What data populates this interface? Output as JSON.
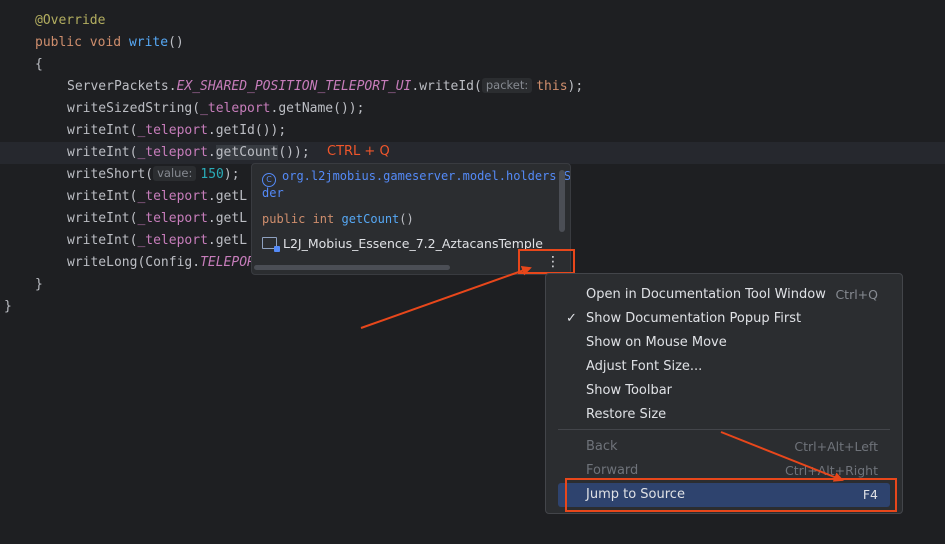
{
  "code": {
    "line1": "@Override",
    "line2_kw1": "public",
    "line2_kw2": "void",
    "line2_fn": "write",
    "line2_rest": "()",
    "line3": "{",
    "line4_a": "ServerPackets.",
    "line4_const": "EX_SHARED_POSITION_TELEPORT_UI",
    "line4_b": ".writeId(",
    "line4_hint": "packet:",
    "line4_this": "this",
    "line4_c": ");",
    "line5_a": "writeSizedString(",
    "line5_f": "_teleport",
    "line5_b": ".getName());",
    "line6_a": "writeInt(",
    "line6_f": "_teleport",
    "line6_b": ".getId());",
    "line7_a": "writeInt(",
    "line7_f": "_teleport",
    "line7_dot": ".",
    "line7_m": "getCount",
    "line7_b": "());",
    "line8_a": "writeShort(",
    "line8_hint": "value:",
    "line8_num": "150",
    "line8_b": ");",
    "line9_a": "writeInt(",
    "line9_f": "_teleport",
    "line9_b": ".getL",
    "line10_a": "writeInt(",
    "line10_f": "_teleport",
    "line10_b": ".getL",
    "line11_a": "writeInt(",
    "line11_f": "_teleport",
    "line11_b": ".getL",
    "line12_a": "writeLong(Config.",
    "line12_const": "TELEPOR",
    "line13": "}",
    "line14": "}"
  },
  "annotation": "CTRL + Q",
  "doc_popup": {
    "class_path_1": "org.l2jmobius.gameserver.model.holders.Sh",
    "class_path_2": "der",
    "signature_kw": "public int",
    "signature_fn": "getCount",
    "signature_rest": "()",
    "module": "L2J_Mobius_Essence_7.2_AztacansTemple",
    "more_label": "⋮"
  },
  "menu": {
    "items": [
      {
        "label": "Open in Documentation Tool Window",
        "shortcut": "Ctrl+Q"
      },
      {
        "label": "Show Documentation Popup First",
        "checked": "✓"
      },
      {
        "label": "Show on Mouse Move"
      },
      {
        "label": "Adjust Font Size..."
      },
      {
        "label": "Show Toolbar"
      },
      {
        "label": "Restore Size"
      },
      {
        "label": "Back",
        "shortcut": "Ctrl+Alt+Left"
      },
      {
        "label": "Forward",
        "shortcut": "Ctrl+Alt+Right"
      },
      {
        "label": "Jump to Source",
        "shortcut": "F4"
      }
    ]
  },
  "colors": {
    "background": "#1e1f22",
    "popup": "#2b2d30",
    "accent_red": "#e8471b",
    "selection": "#2e436e"
  }
}
